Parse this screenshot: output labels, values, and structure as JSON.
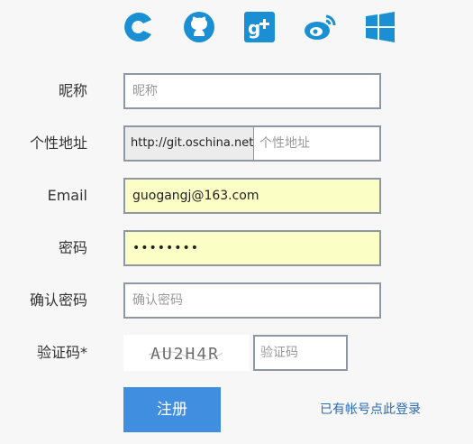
{
  "social": [
    {
      "icon": "oschina-icon",
      "color": "#1a8fd3"
    },
    {
      "icon": "github-icon",
      "color": "#1a8fd3"
    },
    {
      "icon": "google-plus-icon",
      "color": "#1a8fd3"
    },
    {
      "icon": "weibo-icon",
      "color": "#1a8fd3"
    },
    {
      "icon": "windows-icon",
      "color": "#1a8fd3"
    }
  ],
  "form": {
    "nickname": {
      "label": "昵称",
      "placeholder": "昵称",
      "value": ""
    },
    "homepage": {
      "label": "个性地址",
      "prefix": "http://git.oschina.net/",
      "placeholder": "个性地址",
      "value": ""
    },
    "email": {
      "label": "Email",
      "value": "guogangj@163.com"
    },
    "password": {
      "label": "密码",
      "value": "••••••••"
    },
    "confirm": {
      "label": "确认密码",
      "placeholder": "确认密码",
      "value": ""
    },
    "captcha": {
      "label": "验证码*",
      "image_text": "AU2H4R",
      "placeholder": "验证码"
    }
  },
  "actions": {
    "register_label": "注册",
    "login_link": "已有帐号点此登录"
  },
  "colors": {
    "accent": "#3f8ee0",
    "autofill": "#fbffc6",
    "link": "#2a6bb5"
  }
}
